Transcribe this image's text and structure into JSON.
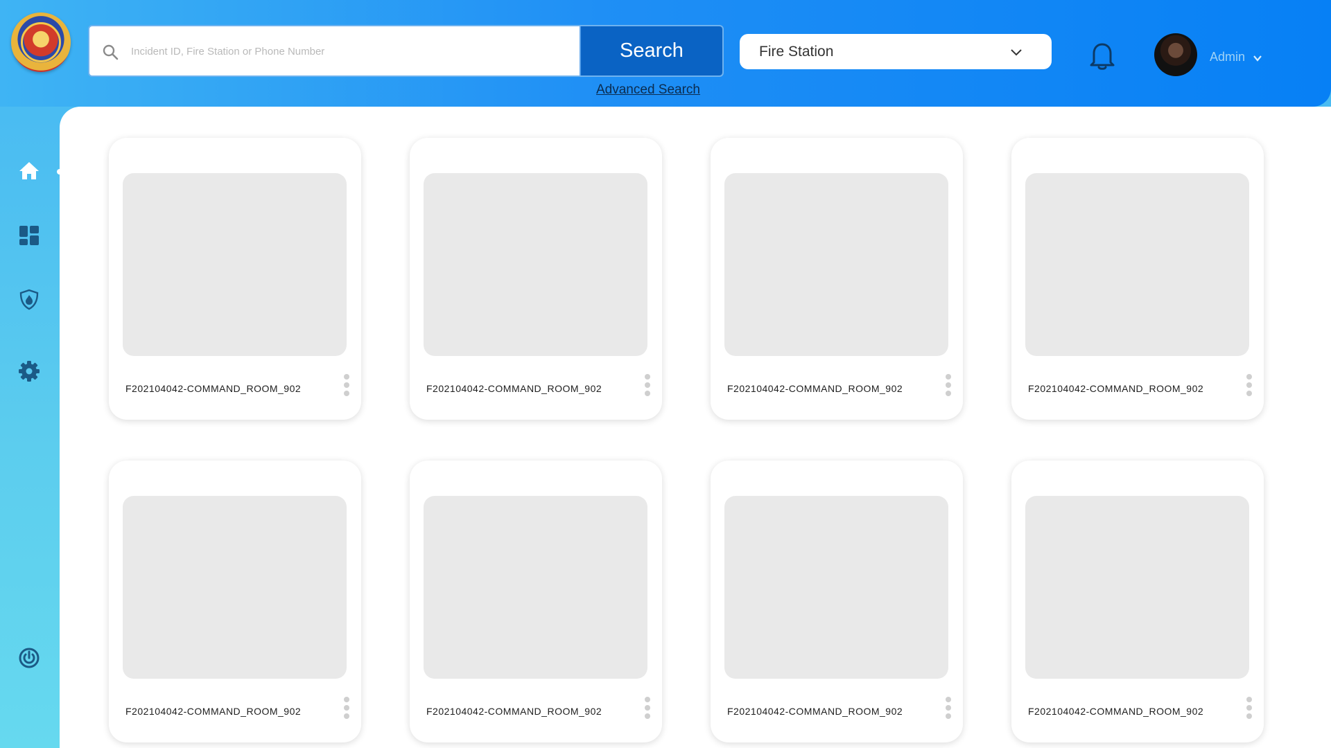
{
  "header": {
    "search": {
      "placeholder": "Incident ID, Fire Station or Phone Number",
      "button_label": "Search",
      "advanced_link": "Advanced Search"
    },
    "station_select": {
      "value": "Fire Station"
    },
    "user": {
      "name": "Admin"
    }
  },
  "sidebar": {
    "items": [
      {
        "name": "home",
        "icon": "home-icon"
      },
      {
        "name": "dashboard",
        "icon": "dashboard-icon"
      },
      {
        "name": "fire-shield",
        "icon": "fire-shield-icon"
      },
      {
        "name": "settings",
        "icon": "gear-icon"
      },
      {
        "name": "power",
        "icon": "power-icon"
      }
    ]
  },
  "cameras": [
    {
      "label": "F202104042-COMMAND_ROOM_902"
    },
    {
      "label": "F202104042-COMMAND_ROOM_902"
    },
    {
      "label": "F202104042-COMMAND_ROOM_902"
    },
    {
      "label": "F202104042-COMMAND_ROOM_902"
    },
    {
      "label": "F202104042-COMMAND_ROOM_902"
    },
    {
      "label": "F202104042-COMMAND_ROOM_902"
    },
    {
      "label": "F202104042-COMMAND_ROOM_902"
    },
    {
      "label": "F202104042-COMMAND_ROOM_902"
    }
  ],
  "colors": {
    "header_start": "#3fb4f4",
    "header_end": "#0780f5",
    "search_button": "#0a63c4",
    "sidebar_icon": "#1b5a86"
  }
}
